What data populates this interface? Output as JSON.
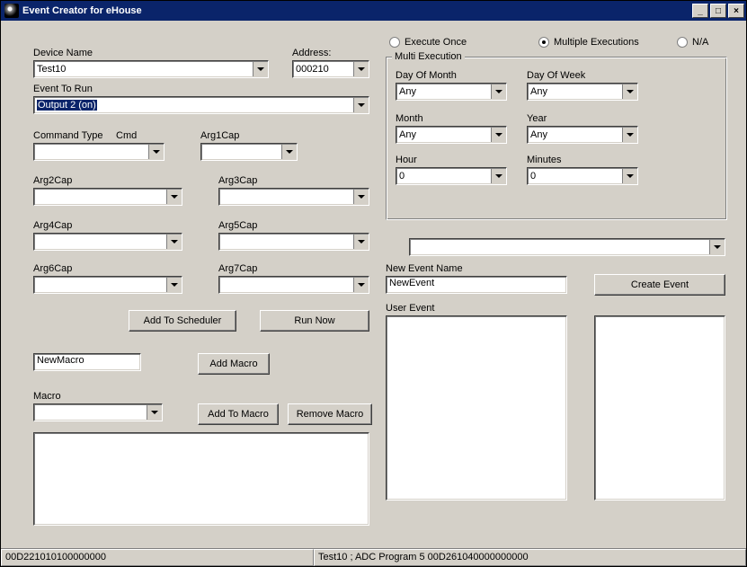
{
  "window": {
    "title": "Event Creator for eHouse"
  },
  "labels": {
    "deviceName": "Device Name",
    "address": "Address:",
    "eventToRun": "Event To Run",
    "commandType": "Command Type",
    "cmd": "Cmd",
    "arg1": "Arg1Cap",
    "arg2": "Arg2Cap",
    "arg3": "Arg3Cap",
    "arg4": "Arg4Cap",
    "arg5": "Arg5Cap",
    "arg6": "Arg6Cap",
    "arg7": "Arg7Cap",
    "macro": "Macro",
    "newEventName": "New Event Name",
    "userEvent": "User Event"
  },
  "combos": {
    "deviceName": "Test10",
    "address": "000210",
    "eventToRun": "Output 2 (on)",
    "commandType": "",
    "arg1": "",
    "arg2": "",
    "arg3": "",
    "arg4": "",
    "arg5": "",
    "arg6": "",
    "arg7": "",
    "macro": "",
    "blank": "",
    "dayOfMonth": "Any",
    "dayOfWeek": "Any",
    "month": "Any",
    "year": "Any",
    "hour": "0",
    "minutes": "0"
  },
  "inputs": {
    "newMacro": "NewMacro",
    "newEventName": "NewEvent"
  },
  "radios": {
    "executeOnce": "Execute Once",
    "multiple": "Multiple Executions",
    "na": "N/A",
    "selected": "multiple"
  },
  "groups": {
    "multiExecution": "Multi Execution",
    "dayOfMonth": "Day Of Month",
    "dayOfWeek": "Day Of Week",
    "month": "Month",
    "year": "Year",
    "hour": "Hour",
    "minutes": "Minutes"
  },
  "buttons": {
    "addToScheduler": "Add To Scheduler",
    "runNow": "Run Now",
    "addMacro": "Add Macro",
    "addToMacro": "Add To Macro",
    "removeMacro": "Remove Macro",
    "createEvent": "Create Event"
  },
  "status": {
    "left": "00D221010100000000",
    "right": "Test10 ; ADC Program 5 00D261040000000000"
  }
}
